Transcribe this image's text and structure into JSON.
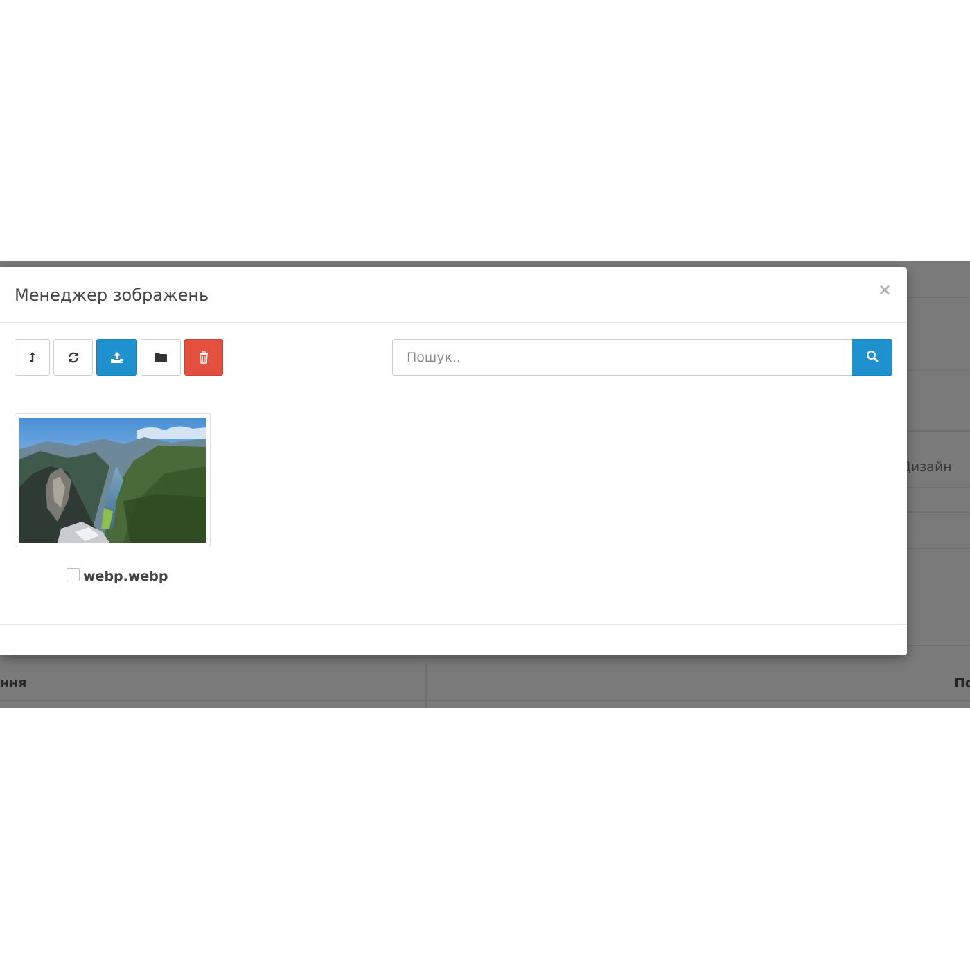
{
  "background": {
    "right_label": "Дизайн",
    "bottom_left_label": "ння",
    "bottom_right_label": "По"
  },
  "modal": {
    "title": "Менеджер зображень",
    "close_symbol": "×"
  },
  "toolbar": {
    "buttons": [
      {
        "name": "parent-folder",
        "icon": "level-up-icon"
      },
      {
        "name": "refresh",
        "icon": "refresh-icon"
      },
      {
        "name": "upload",
        "icon": "upload-icon",
        "color": "#1f91cf"
      },
      {
        "name": "new-folder",
        "icon": "folder-icon"
      },
      {
        "name": "delete",
        "icon": "trash-icon",
        "color": "#e3503e"
      }
    ]
  },
  "search": {
    "placeholder": "Пошук..",
    "value": "",
    "button_icon": "search-icon"
  },
  "files": [
    {
      "name": "webp.webp",
      "checked": false,
      "thumbnail": "mountain-fjord-landscape"
    }
  ]
}
